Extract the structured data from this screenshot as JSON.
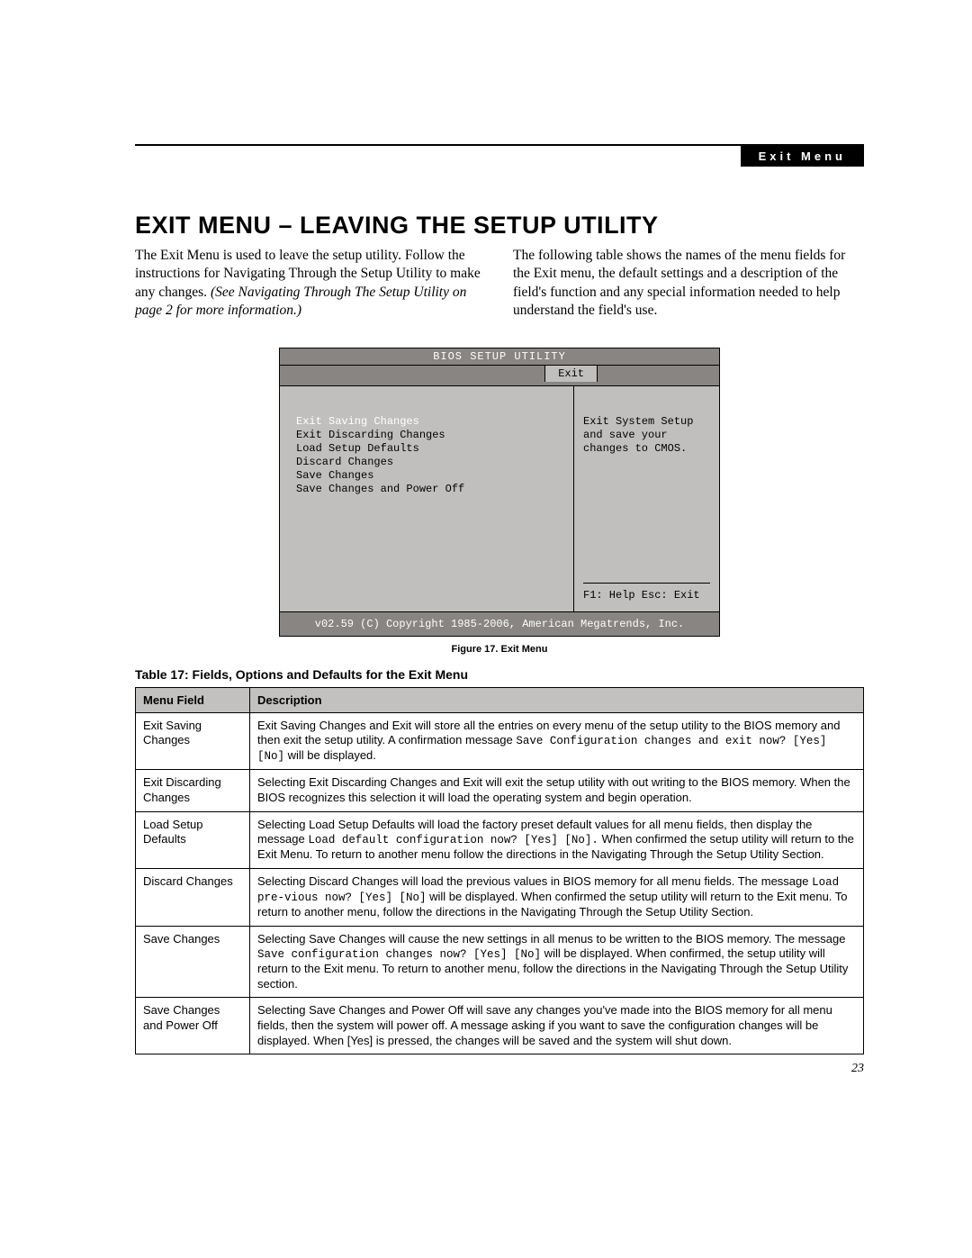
{
  "header": {
    "tag": "Exit Menu"
  },
  "heading": "EXIT MENU – LEAVING THE SETUP UTILITY",
  "intro": {
    "left_plain": "The Exit Menu is used to leave the setup utility. Follow the instructions for Navigating Through the Setup Utility to make any changes. ",
    "left_italic": "(See Navigating Through The Setup Utility on page 2 for more information.)",
    "right": "The following table shows the names of the menu fields for the Exit menu, the default settings and a description of the field's function and any special information needed to help understand the field's use."
  },
  "bios": {
    "title": "BIOS SETUP UTILITY",
    "tab": "Exit",
    "items": [
      "Exit Saving Changes",
      "Exit Discarding Changes",
      "Load Setup Defaults",
      "Discard Changes",
      "Save Changes",
      "Save Changes and Power Off"
    ],
    "help_text": "Exit System Setup and save your changes to CMOS.",
    "help_keys": "F1: Help    Esc: Exit",
    "footer": "v02.59 (C) Copyright 1985-2006, American Megatrends, Inc."
  },
  "figure_caption": "Figure 17.  Exit Menu",
  "table_title": "Table 17: Fields, Options and Defaults for the Exit Menu",
  "table": {
    "head_field": "Menu Field",
    "head_desc": "Description",
    "rows": [
      {
        "field": "Exit Saving Changes",
        "desc_pre": "Exit Saving Changes and Exit will store all the entries on every menu of the setup utility to the BIOS memory and then exit the setup utility. A confirmation message ",
        "desc_code": "Save Configuration changes and exit now? [Yes] [No]",
        "desc_post": " will be displayed."
      },
      {
        "field": "Exit Discarding Changes",
        "desc_pre": "Selecting Exit Discarding Changes and Exit will exit the setup utility with out writing to the BIOS memory. When the BIOS recognizes this selection it will load the operating system and begin operation.",
        "desc_code": "",
        "desc_post": ""
      },
      {
        "field": "Load Setup Defaults",
        "desc_pre": "Selecting Load Setup Defaults will load the factory preset default values for all menu fields, then display the message ",
        "desc_code": "Load default configuration now? [Yes] [No].",
        "desc_post": " When confirmed the setup utility will return to the Exit Menu. To return to another menu follow the directions in the Navigating Through the Setup Utility Section."
      },
      {
        "field": "Discard Changes",
        "desc_pre": "Selecting Discard Changes will load the previous values in BIOS memory for all menu fields. The message ",
        "desc_code": "Load pre-vious now? [Yes] [No]",
        "desc_post": " will be displayed. When confirmed the setup utility will return to the Exit menu. To return to another menu, follow the directions in the Navigating Through the Setup Utility Section."
      },
      {
        "field": "Save Changes",
        "desc_pre": "Selecting Save Changes will cause the new settings in all menus to be written to the BIOS memory. The message ",
        "desc_code": "Save configuration changes now? [Yes] [No]",
        "desc_post": " will be displayed. When confirmed, the setup utility will return to the Exit menu. To return to another menu, follow the directions in the Navigating Through the Setup Utility section."
      },
      {
        "field": "Save Changes and Power Off",
        "desc_pre": "Selecting Save Changes and Power Off will save any changes you've made into the BIOS memory for all menu fields, then the system will power off. A message asking if you want to save the configuration changes will be displayed. When [Yes] is pressed, the changes will be saved and the system will shut down.",
        "desc_code": "",
        "desc_post": ""
      }
    ]
  },
  "page_number": "23"
}
